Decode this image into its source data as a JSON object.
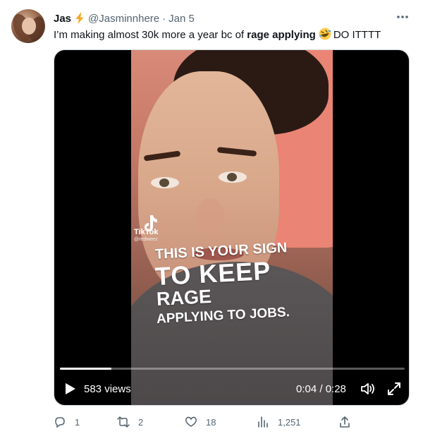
{
  "tweet": {
    "name": "Jas",
    "handle": "@Jasminnhere",
    "separator": "·",
    "date": "Jan 5",
    "text_before": "I’m making almost 30k more a year bc of ",
    "text_bold": "rage applying",
    "text_after": "DO ITTTT",
    "emoji_name": "rolling-laughing-emoji"
  },
  "video": {
    "overlay_lines": [
      "THIS IS YOUR SIGN",
      "TO KEEP",
      "RAGE",
      "APPLYING TO JOBS."
    ],
    "watermark_brand": "TikTok",
    "watermark_user": "@redweez",
    "views": "583 views",
    "time": "0:04 / 0:28",
    "progress": 0.15
  },
  "actions": {
    "replies": "1",
    "retweets": "2",
    "likes": "18",
    "views": "1,251"
  },
  "colors": {
    "secondary_text": "#536471",
    "primary_text": "#0f1419",
    "bolt": "#f4a623"
  }
}
